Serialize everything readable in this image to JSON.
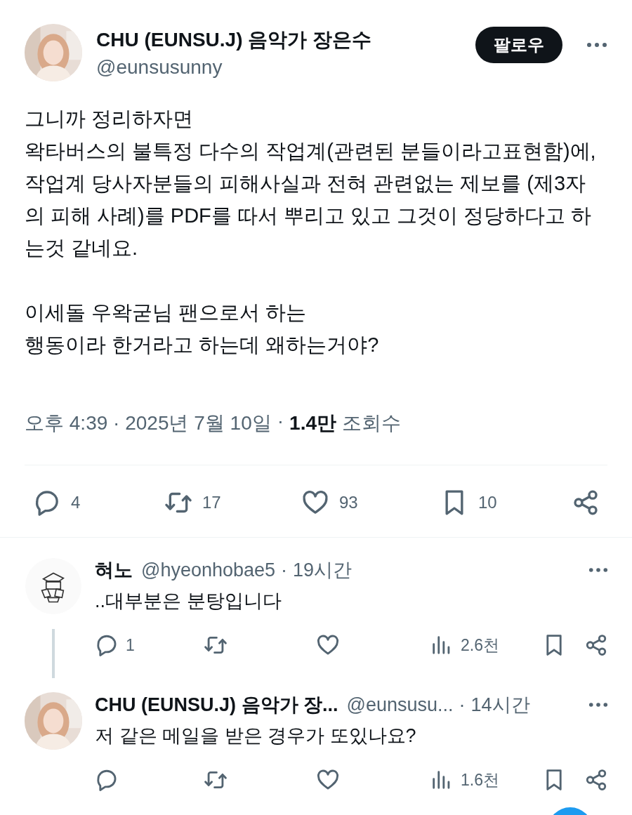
{
  "author": {
    "name": "CHU (EUNSU.J) 음악가 장은수",
    "handle": "@eunsusunny"
  },
  "follow_button": "팔로우",
  "body": "그니까 정리하자면\n왁타버스의 불특정 다수의 작업계(관련된 분들이라고표현함)에, 작업계 당사자분들의 피해사실과 전혀 관련없는 제보를 (제3자의 피해 사례)를 PDF를 따서 뿌리고 있고 그것이 정당하다고 하는것 같네요.\n\n이세돌 우왁굳님 팬으로서 하는\n행동이라 한거라고 하는데 왜하는거야?",
  "meta": {
    "timestamp": "오후 4:39 · 2025년 7월 10일",
    "separator": "·",
    "views": "1.4만",
    "views_label": "조회수"
  },
  "stats": [
    {
      "kind": "reply",
      "count": "4"
    },
    {
      "kind": "retweet",
      "count": "17"
    },
    {
      "kind": "like",
      "count": "93"
    },
    {
      "kind": "bookmark",
      "count": "10"
    },
    {
      "kind": "share"
    }
  ],
  "replies": [
    {
      "name": "혀노",
      "handle": "@hyeonhobae5",
      "separator": "·",
      "age": "19시간",
      "avatar": {
        "kind": "drawing"
      },
      "thread_line": true,
      "text": "..대부분은 분탕입니다",
      "stats": [
        {
          "kind": "reply",
          "count": "1"
        },
        {
          "kind": "retweet"
        },
        {
          "kind": "like"
        },
        {
          "kind": "views",
          "count": "2.6천"
        },
        {
          "kind": "bookmark"
        },
        {
          "kind": "share"
        }
      ]
    },
    {
      "name": "CHU (EUNSU.J) 음악가 장...",
      "handle": "@eunsusu...",
      "separator": "·",
      "age": "14시간",
      "thread_line": false,
      "text": "저 같은 메일을 받은 경우가 또있나요?",
      "stats": [
        {
          "kind": "reply"
        },
        {
          "kind": "retweet"
        },
        {
          "kind": "like"
        },
        {
          "kind": "views",
          "count": "1.6천"
        },
        {
          "kind": "bookmark"
        },
        {
          "kind": "share"
        }
      ]
    }
  ]
}
